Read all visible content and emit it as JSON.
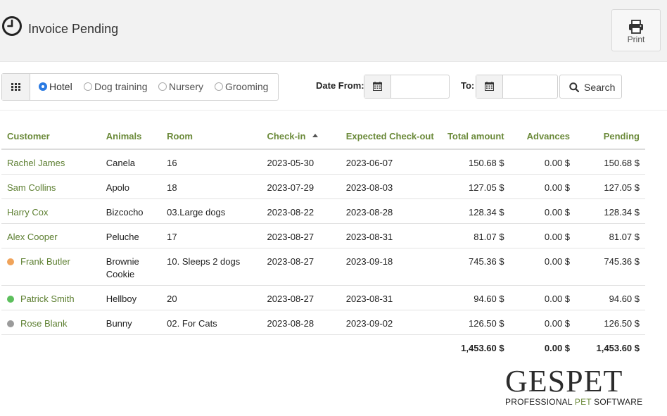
{
  "header": {
    "title": "Invoice Pending",
    "print_label": "Print"
  },
  "filters": {
    "options": [
      {
        "label": "Hotel",
        "checked": true
      },
      {
        "label": "Dog training",
        "checked": false
      },
      {
        "label": "Nursery",
        "checked": false
      },
      {
        "label": "Grooming",
        "checked": false
      }
    ],
    "date_from_label": "Date From:",
    "date_from_value": "",
    "date_to_label": "To:",
    "date_to_value": "",
    "search_label": "Search"
  },
  "table": {
    "columns": {
      "customer": "Customer",
      "animals": "Animals",
      "room": "Room",
      "checkin": "Check-in",
      "checkout": "Expected Check-out",
      "total": "Total amount",
      "advances": "Advances",
      "pending": "Pending"
    },
    "rows": [
      {
        "customer": "Rachel James",
        "status": "",
        "animals": [
          "Canela"
        ],
        "room": "16",
        "checkin": "2023-05-30",
        "checkout": "2023-06-07",
        "total": "150.68 $",
        "advances": "0.00 $",
        "pending": "150.68 $"
      },
      {
        "customer": "Sam Collins",
        "status": "",
        "animals": [
          "Apolo"
        ],
        "room": "18",
        "checkin": "2023-07-29",
        "checkout": "2023-08-03",
        "total": "127.05 $",
        "advances": "0.00 $",
        "pending": "127.05 $"
      },
      {
        "customer": "Harry Cox",
        "status": "",
        "animals": [
          "Bizcocho"
        ],
        "room": "03.Large dogs",
        "checkin": "2023-08-22",
        "checkout": "2023-08-28",
        "total": "128.34 $",
        "advances": "0.00 $",
        "pending": "128.34 $"
      },
      {
        "customer": "Alex Cooper",
        "status": "",
        "animals": [
          "Peluche"
        ],
        "room": "17",
        "checkin": "2023-08-27",
        "checkout": "2023-08-31",
        "total": "81.07 $",
        "advances": "0.00 $",
        "pending": "81.07 $"
      },
      {
        "customer": "Frank Butler",
        "status": "#f0a35a",
        "animals": [
          "Brownie",
          "Cookie"
        ],
        "room": "10. Sleeps 2 dogs",
        "checkin": "2023-08-27",
        "checkout": "2023-09-18",
        "total": "745.36 $",
        "advances": "0.00 $",
        "pending": "745.36 $"
      },
      {
        "customer": "Patrick Smith",
        "status": "#5cbf5c",
        "animals": [
          "Hellboy"
        ],
        "room": "20",
        "checkin": "2023-08-27",
        "checkout": "2023-08-31",
        "total": "94.60 $",
        "advances": "0.00 $",
        "pending": "94.60 $"
      },
      {
        "customer": "Rose Blank",
        "status": "#9b9b9b",
        "animals": [
          "Bunny"
        ],
        "room": "02. For Cats",
        "checkin": "2023-08-28",
        "checkout": "2023-09-02",
        "total": "126.50 $",
        "advances": "0.00 $",
        "pending": "126.50 $"
      }
    ],
    "totals": {
      "total": "1,453.60 $",
      "advances": "0.00 $",
      "pending": "1,453.60 $"
    }
  },
  "logo": {
    "mark_ges": "GES",
    "mark_pet": "PET",
    "tag_pre": "PROFESSIONAL ",
    "tag_pet": "PET",
    "tag_post": " SOFTWARE"
  },
  "colors": {
    "accent_green": "#6b8a3a",
    "customer_link": "#5d7f31",
    "radio_selected": "#2a7ae2"
  }
}
